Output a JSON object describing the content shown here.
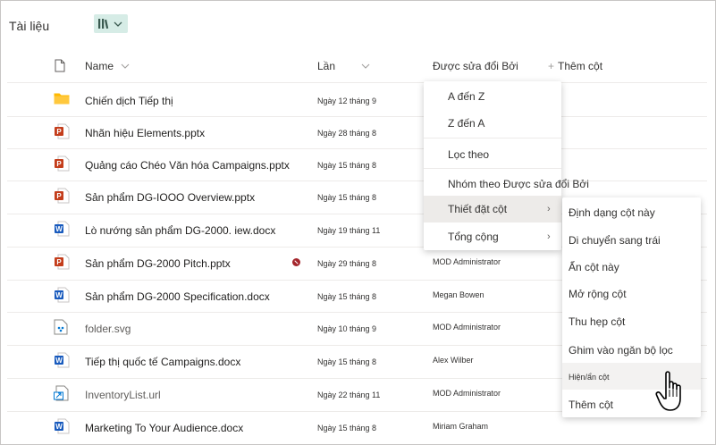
{
  "library": {
    "title": "Tài liệu",
    "view_icon": "library-view-icon"
  },
  "columns": {
    "name": "Name",
    "date": "Lần",
    "modified_by": "Được sửa đổi Bởi",
    "add_column": "Thêm cột",
    "add_symbol": "+"
  },
  "files": [
    {
      "icon": "folder",
      "name": "Chiến dịch Tiếp thị",
      "date": "Ngày 12 tháng 9",
      "modified_by": ""
    },
    {
      "icon": "pptx",
      "name": "Nhãn hiệu Elements.pptx",
      "date": "Ngày 28 tháng 8",
      "modified_by": ""
    },
    {
      "icon": "pptx",
      "name": "Quảng cáo Chéo Văn hóa Campaigns.pptx",
      "date": "Ngày 15 tháng 8",
      "modified_by": ""
    },
    {
      "icon": "pptx",
      "name": "Sản phẩm DG-IOOO Overview.pptx",
      "date": "Ngày 15 tháng 8",
      "modified_by": ""
    },
    {
      "icon": "docx",
      "name": "Lò nướng sản phẩm DG-2000. iew.docx",
      "date": "Ngày 19 tháng 11",
      "modified_by": ""
    },
    {
      "icon": "pptx",
      "name": "Sản phẩm DG-2000 Pitch.pptx",
      "date": "Ngày 29 tháng 8",
      "modified_by": "MOD Administrator",
      "badge": true
    },
    {
      "icon": "docx",
      "name": "Sản phẩm DG-2000 Specification.docx",
      "date": "Ngày 15 tháng 8",
      "modified_by": "Megan Bowen"
    },
    {
      "icon": "svg",
      "name": "folder.svg",
      "date": "Ngày 10 tháng 9",
      "modified_by": "MOD Administrator",
      "link": true
    },
    {
      "icon": "docx",
      "name": "Tiếp thị quốc tế Campaigns.docx",
      "date": "Ngày 15 tháng 8",
      "modified_by": "Alex Wilber"
    },
    {
      "icon": "url",
      "name": "InventoryList.url",
      "date": "Ngày 22 tháng 11",
      "modified_by": "MOD Administrator",
      "link": true
    },
    {
      "icon": "docx",
      "name": "Marketing To Your Audience.docx",
      "date": "Ngày 15 tháng 8",
      "modified_by": "Miriam Graham"
    }
  ],
  "column_menu": {
    "items": [
      {
        "label": "A đến Z"
      },
      {
        "label": "Z đến A"
      },
      {
        "label": "Lọc theo"
      },
      {
        "label": "Nhóm theo Được sửa đổi Bởi"
      },
      {
        "label": "Thiết đặt cột",
        "submenu": true,
        "active": true
      },
      {
        "label": "Tổng cộng",
        "submenu": true
      }
    ],
    "chevron": "›"
  },
  "settings_submenu": {
    "items": [
      {
        "label": "Định dạng cột này"
      },
      {
        "label": "Di chuyển sang trái"
      },
      {
        "label": "Ẩn cột này"
      },
      {
        "label": "Mở rộng cột"
      },
      {
        "label": "Thu hẹp cột"
      },
      {
        "label": "Ghim vào ngăn bộ lọc"
      },
      {
        "label": "Hiện/ẩn cột",
        "hover": true
      },
      {
        "label": "Thêm cột"
      }
    ]
  },
  "colors": {
    "accent": "#0078d4",
    "view_button_bg": "#d6ece6",
    "pptx": "#c43e1c",
    "docx": "#185abd",
    "folder": "#ffb900"
  }
}
